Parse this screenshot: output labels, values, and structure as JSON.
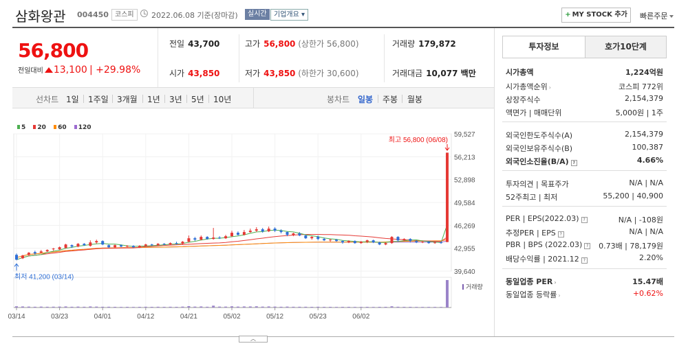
{
  "header": {
    "name": "삼화왕관",
    "code": "004450",
    "market_tag": "코스피",
    "date": "2022.06.08 기준(장마감)",
    "realtime": "실시간",
    "company_info": "기업개요",
    "mystock": "MY STOCK 추가",
    "quick_order": "빠른주문"
  },
  "price": {
    "current": "56,800",
    "change_label": "전일대비",
    "change": "13,100",
    "rate": "+29.98%"
  },
  "stats": {
    "prev_label": "전일",
    "prev": "43,700",
    "high_label": "고가",
    "high": "56,800",
    "high_limit": "(상한가 56,800)",
    "volume_label": "거래량",
    "volume": "179,872",
    "open_label": "시가",
    "open": "43,850",
    "low_label": "저가",
    "low": "43,850",
    "low_limit": "(하한가 30,600)",
    "amount_label": "거래대금",
    "amount": "10,077 백만"
  },
  "range": {
    "line_label": "선차트",
    "line_options": [
      "1일",
      "1주일",
      "3개월",
      "1년",
      "3년",
      "5년",
      "10년"
    ],
    "candle_label": "봉차트",
    "candle_options": [
      "일봉",
      "주봉",
      "월봉"
    ],
    "selected": "일봉"
  },
  "legend": [
    {
      "label": "5",
      "color": "#4caf50"
    },
    {
      "label": "20",
      "color": "#e53935"
    },
    {
      "label": "60",
      "color": "#ff8a00"
    },
    {
      "label": "120",
      "color": "#9c6ad0"
    }
  ],
  "chart_data": {
    "type": "candlestick",
    "x_ticks": [
      "03/14",
      "03/23",
      "04/01",
      "04/12",
      "04/21",
      "05/02",
      "05/12",
      "05/23",
      "06/02"
    ],
    "y_ticks": [
      59527,
      56213,
      52898,
      49584,
      46269,
      42955,
      39640
    ],
    "high_annotation": "최고 56,800 (06/08)",
    "low_annotation": "최저 41,200 (03/14)",
    "volume_label": "거래량",
    "candles": [
      {
        "o": 42000,
        "c": 41300,
        "h": 42200,
        "l": 41200
      },
      {
        "o": 41500,
        "c": 41900,
        "h": 42000,
        "l": 41400
      },
      {
        "o": 42000,
        "c": 42300,
        "h": 42400,
        "l": 41800
      },
      {
        "o": 42400,
        "c": 42200,
        "h": 42600,
        "l": 42000
      },
      {
        "o": 42300,
        "c": 42500,
        "h": 42700,
        "l": 42200
      },
      {
        "o": 42500,
        "c": 42700,
        "h": 42800,
        "l": 42400
      },
      {
        "o": 42800,
        "c": 42900,
        "h": 43000,
        "l": 42600
      },
      {
        "o": 42800,
        "c": 43100,
        "h": 43200,
        "l": 42700
      },
      {
        "o": 43000,
        "c": 43500,
        "h": 43600,
        "l": 42900
      },
      {
        "o": 43400,
        "c": 43200,
        "h": 43500,
        "l": 43000
      },
      {
        "o": 43200,
        "c": 43600,
        "h": 43700,
        "l": 43100
      },
      {
        "o": 43600,
        "c": 43400,
        "h": 43700,
        "l": 43300
      },
      {
        "o": 43300,
        "c": 43800,
        "h": 44100,
        "l": 43200
      },
      {
        "o": 43800,
        "c": 44000,
        "h": 44200,
        "l": 43600
      },
      {
        "o": 44000,
        "c": 43500,
        "h": 44100,
        "l": 43400
      },
      {
        "o": 43400,
        "c": 43100,
        "h": 43500,
        "l": 43000
      },
      {
        "o": 43100,
        "c": 43400,
        "h": 43500,
        "l": 43000
      },
      {
        "o": 43400,
        "c": 43200,
        "h": 43500,
        "l": 43100
      },
      {
        "o": 43200,
        "c": 43300,
        "h": 43400,
        "l": 43100
      },
      {
        "o": 43300,
        "c": 43100,
        "h": 43400,
        "l": 43000
      },
      {
        "o": 43100,
        "c": 43300,
        "h": 43400,
        "l": 43000
      },
      {
        "o": 43300,
        "c": 43500,
        "h": 43600,
        "l": 43200
      },
      {
        "o": 43500,
        "c": 43400,
        "h": 43600,
        "l": 43300
      },
      {
        "o": 43400,
        "c": 43600,
        "h": 43700,
        "l": 43300
      },
      {
        "o": 43600,
        "c": 43500,
        "h": 43700,
        "l": 43400
      },
      {
        "o": 43500,
        "c": 43700,
        "h": 43800,
        "l": 43400
      },
      {
        "o": 43700,
        "c": 43600,
        "h": 43900,
        "l": 43500
      },
      {
        "o": 43600,
        "c": 43900,
        "h": 44000,
        "l": 43500
      },
      {
        "o": 43900,
        "c": 44400,
        "h": 44800,
        "l": 43800
      },
      {
        "o": 44400,
        "c": 44200,
        "h": 44600,
        "l": 44000
      },
      {
        "o": 44200,
        "c": 44600,
        "h": 44800,
        "l": 44100
      },
      {
        "o": 44600,
        "c": 44300,
        "h": 44700,
        "l": 44200
      },
      {
        "o": 44300,
        "c": 44500,
        "h": 45900,
        "l": 44200
      },
      {
        "o": 44500,
        "c": 44400,
        "h": 44700,
        "l": 44300
      },
      {
        "o": 44400,
        "c": 44700,
        "h": 44900,
        "l": 44300
      },
      {
        "o": 44700,
        "c": 45200,
        "h": 45500,
        "l": 44600
      },
      {
        "o": 45200,
        "c": 44900,
        "h": 45400,
        "l": 44800
      },
      {
        "o": 44900,
        "c": 45300,
        "h": 45600,
        "l": 44800
      },
      {
        "o": 45300,
        "c": 45500,
        "h": 45800,
        "l": 45200
      },
      {
        "o": 45500,
        "c": 45700,
        "h": 46000,
        "l": 45300
      },
      {
        "o": 45700,
        "c": 45400,
        "h": 45900,
        "l": 45200
      },
      {
        "o": 45400,
        "c": 45800,
        "h": 46100,
        "l": 45300
      },
      {
        "o": 45800,
        "c": 45500,
        "h": 46000,
        "l": 45300
      },
      {
        "o": 45500,
        "c": 45300,
        "h": 45700,
        "l": 45100
      },
      {
        "o": 45300,
        "c": 44900,
        "h": 45400,
        "l": 44700
      },
      {
        "o": 44900,
        "c": 45100,
        "h": 45200,
        "l": 44700
      },
      {
        "o": 45100,
        "c": 44800,
        "h": 45300,
        "l": 44700
      },
      {
        "o": 44800,
        "c": 44400,
        "h": 44900,
        "l": 44300
      },
      {
        "o": 44400,
        "c": 44600,
        "h": 44700,
        "l": 44200
      },
      {
        "o": 44600,
        "c": 44300,
        "h": 44800,
        "l": 44100
      },
      {
        "o": 44300,
        "c": 44100,
        "h": 44500,
        "l": 44000
      },
      {
        "o": 44100,
        "c": 44200,
        "h": 44300,
        "l": 43900
      },
      {
        "o": 44200,
        "c": 44000,
        "h": 44300,
        "l": 43900
      },
      {
        "o": 44000,
        "c": 43800,
        "h": 44100,
        "l": 43600
      },
      {
        "o": 43800,
        "c": 44000,
        "h": 44100,
        "l": 43700
      },
      {
        "o": 44000,
        "c": 43700,
        "h": 44100,
        "l": 43600
      },
      {
        "o": 43700,
        "c": 43900,
        "h": 44000,
        "l": 43600
      },
      {
        "o": 43900,
        "c": 44100,
        "h": 44200,
        "l": 43700
      },
      {
        "o": 44100,
        "c": 43800,
        "h": 44200,
        "l": 43700
      },
      {
        "o": 43800,
        "c": 43500,
        "h": 43900,
        "l": 43400
      },
      {
        "o": 43500,
        "c": 43700,
        "h": 43800,
        "l": 43400
      },
      {
        "o": 43700,
        "c": 44600,
        "h": 44700,
        "l": 43600
      },
      {
        "o": 44600,
        "c": 44100,
        "h": 44700,
        "l": 43900
      },
      {
        "o": 44100,
        "c": 44300,
        "h": 44400,
        "l": 44000
      },
      {
        "o": 44300,
        "c": 44000,
        "h": 44400,
        "l": 43800
      },
      {
        "o": 44000,
        "c": 43800,
        "h": 44100,
        "l": 43700
      },
      {
        "o": 43800,
        "c": 43900,
        "h": 44000,
        "l": 43700
      },
      {
        "o": 43900,
        "c": 43700,
        "h": 44000,
        "l": 43600
      },
      {
        "o": 43700,
        "c": 43800,
        "h": 43900,
        "l": 43600
      },
      {
        "o": 43800,
        "c": 43700,
        "h": 43900,
        "l": 43600
      },
      {
        "o": 43850,
        "c": 56800,
        "h": 56800,
        "l": 43850
      }
    ],
    "volumes": [
      8000,
      7000,
      6000,
      5000,
      6000,
      5000,
      5500,
      6000,
      7000,
      5000,
      6000,
      5000,
      7000,
      6000,
      5000,
      5000,
      4500,
      4000,
      4500,
      4000,
      4500,
      5000,
      4500,
      5000,
      4500,
      5000,
      4500,
      6000,
      9000,
      6000,
      7000,
      5000,
      12000,
      6000,
      6000,
      8000,
      6000,
      7000,
      7000,
      8000,
      6000,
      7000,
      6000,
      5000,
      6000,
      5000,
      5000,
      5000,
      4500,
      5000,
      4500,
      4500,
      4000,
      4500,
      4500,
      4000,
      4000,
      4500,
      4000,
      4500,
      4500,
      8000,
      5000,
      4500,
      4500,
      4000,
      4000,
      4000,
      4000,
      4000,
      179872
    ]
  },
  "side": {
    "tab_active": "투자정보",
    "tab_other": "호가10단계",
    "market_cap_label": "시가총액",
    "market_cap": "1,224억원",
    "cap_rank_label": "시가총액순위",
    "cap_rank": "코스피 772위",
    "shares_label": "상장주식수",
    "shares": "2,154,379",
    "face_label": "액면가 | 매매단위",
    "face": "5,000원 | 1주",
    "foreign_limit_label": "외국인한도주식수(A)",
    "foreign_limit": "2,154,379",
    "foreign_hold_label": "외국인보유주식수(B)",
    "foreign_hold": "100,387",
    "foreign_rate_label": "외국인소진율(B/A)",
    "foreign_rate": "4.66%",
    "opinion_label": "투자의견 | 목표주가",
    "opinion": "N/A | N/A",
    "w52_label": "52주최고 | 최저",
    "w52": "55,200 | 40,900",
    "per_label": "PER | EPS(2022.03)",
    "per": "N/A | -108원",
    "eper_label": "추정PER | EPS",
    "eper": "N/A | N/A",
    "pbr_label": "PBR | BPS (2022.03)",
    "pbr": "0.73배 | 78,179원",
    "div_label": "배당수익률 | 2021.12",
    "div": "2.20%",
    "ind_per_label": "동일업종 PER",
    "ind_per": "15.47배",
    "ind_rate_label": "동일업종 등락률",
    "ind_rate": "+0.62%"
  }
}
